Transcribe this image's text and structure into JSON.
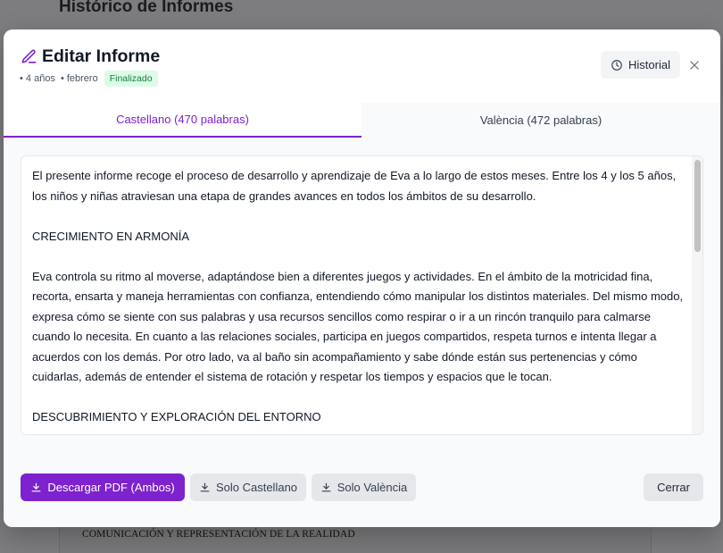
{
  "background": {
    "page_title": "Histórico de Informes",
    "doc_heading": "COMUNICACIÓN Y REPRESENTACIÓN DE LA REALIDAD"
  },
  "modal": {
    "title": "Editar Informe",
    "meta_age": "• 4 años",
    "meta_month": "• febrero",
    "status": "Finalizado",
    "history_label": "Historial"
  },
  "tabs": [
    {
      "label": "Castellano (470 palabras)",
      "active": true
    },
    {
      "label": "València (472 palabras)",
      "active": false
    }
  ],
  "editor": {
    "paragraphs": [
      "El presente informe recoge el proceso de desarrollo y aprendizaje de Eva a lo largo de estos meses. Entre los 4 y los 5 años, los niños y niñas atraviesan una etapa de grandes avances en todos los ámbitos de su desarrollo.",
      "CRECIMIENTO EN ARMONÍA",
      "Eva controla su ritmo al moverse, adaptándose bien a diferentes juegos y actividades. En el ámbito de la motricidad fina, recorta, ensarta y maneja herramientas con confianza, entendiendo cómo manipular los distintos materiales. Del mismo modo, expresa cómo se siente con sus palabras y usa recursos sencillos como respirar o ir a un rincón tranquilo para calmarse cuando lo necesita. En cuanto a las relaciones sociales, participa en juegos compartidos, respeta turnos e intenta llegar a acuerdos con los demás. Por otro lado, va al baño sin acompañamiento y sabe dónde están sus pertenencias y cómo cuidarlas, además de entender el sistema de rotación y respetar los tiempos y espacios que le tocan.",
      "DESCUBRIMIENTO Y EXPLORACIÓN DEL ENTORNO"
    ]
  },
  "footer": {
    "download_both": "Descargar PDF (Ambos)",
    "download_castellano": "Solo Castellano",
    "download_valencia": "Solo València",
    "close": "Cerrar"
  },
  "colors": {
    "accent": "#7e22ce",
    "status_bg": "#dcfce7",
    "status_text": "#15803d"
  }
}
